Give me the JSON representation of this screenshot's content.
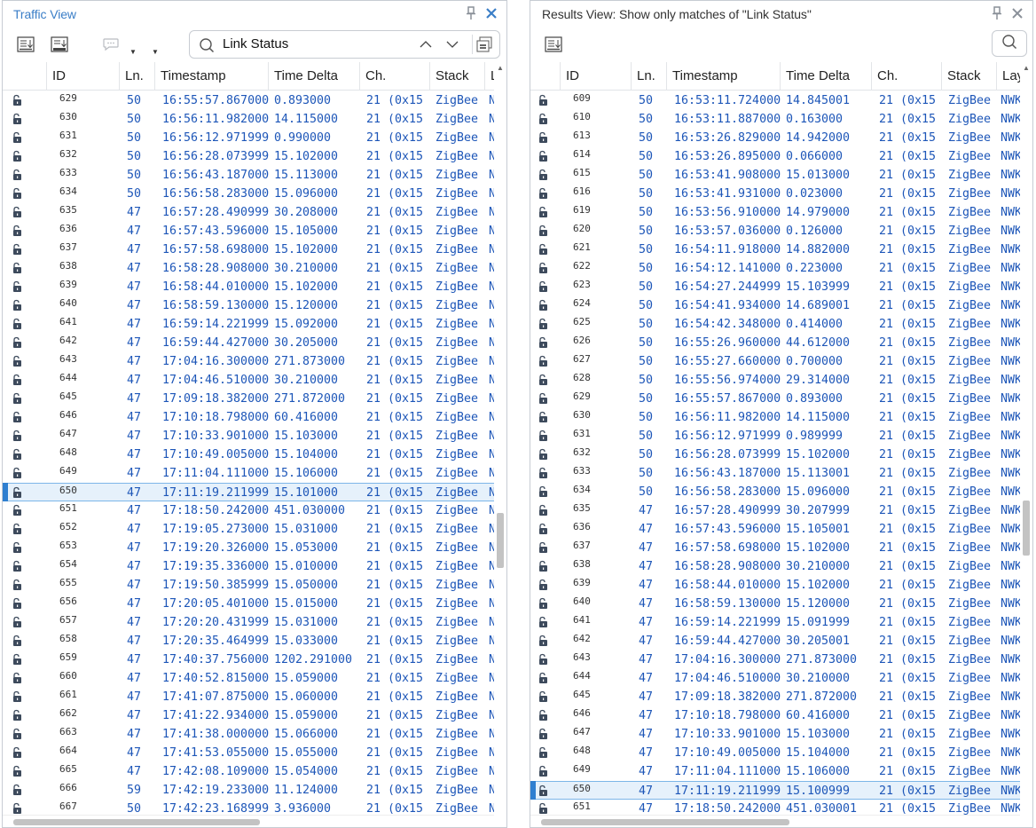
{
  "left": {
    "title": "Traffic View",
    "search_value": "Link Status",
    "columns": [
      "ID",
      "Ln.",
      "Timestamp",
      "Time Delta",
      "Ch.",
      "Stack",
      "L"
    ],
    "selected_id": "650",
    "rows": [
      [
        "629",
        "50",
        "16:55:57.867000",
        "0.893000",
        "21 (0x15",
        "ZigBee",
        "N"
      ],
      [
        "630",
        "50",
        "16:56:11.982000",
        "14.115000",
        "21 (0x15",
        "ZigBee",
        "N"
      ],
      [
        "631",
        "50",
        "16:56:12.971999",
        "0.990000",
        "21 (0x15",
        "ZigBee",
        "N"
      ],
      [
        "632",
        "50",
        "16:56:28.073999",
        "15.102000",
        "21 (0x15",
        "ZigBee",
        "N"
      ],
      [
        "633",
        "50",
        "16:56:43.187000",
        "15.113000",
        "21 (0x15",
        "ZigBee",
        "N"
      ],
      [
        "634",
        "50",
        "16:56:58.283000",
        "15.096000",
        "21 (0x15",
        "ZigBee",
        "N"
      ],
      [
        "635",
        "47",
        "16:57:28.490999",
        "30.208000",
        "21 (0x15",
        "ZigBee",
        "N"
      ],
      [
        "636",
        "47",
        "16:57:43.596000",
        "15.105000",
        "21 (0x15",
        "ZigBee",
        "N"
      ],
      [
        "637",
        "47",
        "16:57:58.698000",
        "15.102000",
        "21 (0x15",
        "ZigBee",
        "N"
      ],
      [
        "638",
        "47",
        "16:58:28.908000",
        "30.210000",
        "21 (0x15",
        "ZigBee",
        "N"
      ],
      [
        "639",
        "47",
        "16:58:44.010000",
        "15.102000",
        "21 (0x15",
        "ZigBee",
        "N"
      ],
      [
        "640",
        "47",
        "16:58:59.130000",
        "15.120000",
        "21 (0x15",
        "ZigBee",
        "N"
      ],
      [
        "641",
        "47",
        "16:59:14.221999",
        "15.092000",
        "21 (0x15",
        "ZigBee",
        "N"
      ],
      [
        "642",
        "47",
        "16:59:44.427000",
        "30.205000",
        "21 (0x15",
        "ZigBee",
        "N"
      ],
      [
        "643",
        "47",
        "17:04:16.300000",
        "271.873000",
        "21 (0x15",
        "ZigBee",
        "N"
      ],
      [
        "644",
        "47",
        "17:04:46.510000",
        "30.210000",
        "21 (0x15",
        "ZigBee",
        "N"
      ],
      [
        "645",
        "47",
        "17:09:18.382000",
        "271.872000",
        "21 (0x15",
        "ZigBee",
        "N"
      ],
      [
        "646",
        "47",
        "17:10:18.798000",
        "60.416000",
        "21 (0x15",
        "ZigBee",
        "N"
      ],
      [
        "647",
        "47",
        "17:10:33.901000",
        "15.103000",
        "21 (0x15",
        "ZigBee",
        "N"
      ],
      [
        "648",
        "47",
        "17:10:49.005000",
        "15.104000",
        "21 (0x15",
        "ZigBee",
        "N"
      ],
      [
        "649",
        "47",
        "17:11:04.111000",
        "15.106000",
        "21 (0x15",
        "ZigBee",
        "N"
      ],
      [
        "650",
        "47",
        "17:11:19.211999",
        "15.101000",
        "21 (0x15",
        "ZigBee",
        "N"
      ],
      [
        "651",
        "47",
        "17:18:50.242000",
        "451.030000",
        "21 (0x15",
        "ZigBee",
        "N"
      ],
      [
        "652",
        "47",
        "17:19:05.273000",
        "15.031000",
        "21 (0x15",
        "ZigBee",
        "N"
      ],
      [
        "653",
        "47",
        "17:19:20.326000",
        "15.053000",
        "21 (0x15",
        "ZigBee",
        "N"
      ],
      [
        "654",
        "47",
        "17:19:35.336000",
        "15.010000",
        "21 (0x15",
        "ZigBee",
        "N"
      ],
      [
        "655",
        "47",
        "17:19:50.385999",
        "15.050000",
        "21 (0x15",
        "ZigBee",
        "N"
      ],
      [
        "656",
        "47",
        "17:20:05.401000",
        "15.015000",
        "21 (0x15",
        "ZigBee",
        "N"
      ],
      [
        "657",
        "47",
        "17:20:20.431999",
        "15.031000",
        "21 (0x15",
        "ZigBee",
        "N"
      ],
      [
        "658",
        "47",
        "17:20:35.464999",
        "15.033000",
        "21 (0x15",
        "ZigBee",
        "N"
      ],
      [
        "659",
        "47",
        "17:40:37.756000",
        "1202.291000",
        "21 (0x15",
        "ZigBee",
        "N"
      ],
      [
        "660",
        "47",
        "17:40:52.815000",
        "15.059000",
        "21 (0x15",
        "ZigBee",
        "N"
      ],
      [
        "661",
        "47",
        "17:41:07.875000",
        "15.060000",
        "21 (0x15",
        "ZigBee",
        "N"
      ],
      [
        "662",
        "47",
        "17:41:22.934000",
        "15.059000",
        "21 (0x15",
        "ZigBee",
        "N"
      ],
      [
        "663",
        "47",
        "17:41:38.000000",
        "15.066000",
        "21 (0x15",
        "ZigBee",
        "N"
      ],
      [
        "664",
        "47",
        "17:41:53.055000",
        "15.055000",
        "21 (0x15",
        "ZigBee",
        "N"
      ],
      [
        "665",
        "47",
        "17:42:08.109000",
        "15.054000",
        "21 (0x15",
        "ZigBee",
        "N"
      ],
      [
        "666",
        "59",
        "17:42:19.233000",
        "11.124000",
        "21 (0x15",
        "ZigBee",
        "N"
      ],
      [
        "667",
        "50",
        "17:42:23.168999",
        "3.936000",
        "21 (0x15",
        "ZigBee",
        "N"
      ]
    ]
  },
  "right": {
    "title": "Results View: Show only matches of \"Link Status\"",
    "columns": [
      "ID",
      "Ln.",
      "Timestamp",
      "Time Delta",
      "Ch.",
      "Stack",
      "Lay"
    ],
    "selected_id": "650",
    "rows": [
      [
        "609",
        "50",
        "16:53:11.724000",
        "14.845001",
        "21 (0x15",
        "ZigBee",
        "NWK"
      ],
      [
        "610",
        "50",
        "16:53:11.887000",
        "0.163000",
        "21 (0x15",
        "ZigBee",
        "NWK"
      ],
      [
        "613",
        "50",
        "16:53:26.829000",
        "14.942000",
        "21 (0x15",
        "ZigBee",
        "NWK"
      ],
      [
        "614",
        "50",
        "16:53:26.895000",
        "0.066000",
        "21 (0x15",
        "ZigBee",
        "NWK"
      ],
      [
        "615",
        "50",
        "16:53:41.908000",
        "15.013000",
        "21 (0x15",
        "ZigBee",
        "NWK"
      ],
      [
        "616",
        "50",
        "16:53:41.931000",
        "0.023000",
        "21 (0x15",
        "ZigBee",
        "NWK"
      ],
      [
        "619",
        "50",
        "16:53:56.910000",
        "14.979000",
        "21 (0x15",
        "ZigBee",
        "NWK"
      ],
      [
        "620",
        "50",
        "16:53:57.036000",
        "0.126000",
        "21 (0x15",
        "ZigBee",
        "NWK"
      ],
      [
        "621",
        "50",
        "16:54:11.918000",
        "14.882000",
        "21 (0x15",
        "ZigBee",
        "NWK"
      ],
      [
        "622",
        "50",
        "16:54:12.141000",
        "0.223000",
        "21 (0x15",
        "ZigBee",
        "NWK"
      ],
      [
        "623",
        "50",
        "16:54:27.244999",
        "15.103999",
        "21 (0x15",
        "ZigBee",
        "NWK"
      ],
      [
        "624",
        "50",
        "16:54:41.934000",
        "14.689001",
        "21 (0x15",
        "ZigBee",
        "NWK"
      ],
      [
        "625",
        "50",
        "16:54:42.348000",
        "0.414000",
        "21 (0x15",
        "ZigBee",
        "NWK"
      ],
      [
        "626",
        "50",
        "16:55:26.960000",
        "44.612000",
        "21 (0x15",
        "ZigBee",
        "NWK"
      ],
      [
        "627",
        "50",
        "16:55:27.660000",
        "0.700000",
        "21 (0x15",
        "ZigBee",
        "NWK"
      ],
      [
        "628",
        "50",
        "16:55:56.974000",
        "29.314000",
        "21 (0x15",
        "ZigBee",
        "NWK"
      ],
      [
        "629",
        "50",
        "16:55:57.867000",
        "0.893000",
        "21 (0x15",
        "ZigBee",
        "NWK"
      ],
      [
        "630",
        "50",
        "16:56:11.982000",
        "14.115000",
        "21 (0x15",
        "ZigBee",
        "NWK"
      ],
      [
        "631",
        "50",
        "16:56:12.971999",
        "0.989999",
        "21 (0x15",
        "ZigBee",
        "NWK"
      ],
      [
        "632",
        "50",
        "16:56:28.073999",
        "15.102000",
        "21 (0x15",
        "ZigBee",
        "NWK"
      ],
      [
        "633",
        "50",
        "16:56:43.187000",
        "15.113001",
        "21 (0x15",
        "ZigBee",
        "NWK"
      ],
      [
        "634",
        "50",
        "16:56:58.283000",
        "15.096000",
        "21 (0x15",
        "ZigBee",
        "NWK"
      ],
      [
        "635",
        "47",
        "16:57:28.490999",
        "30.207999",
        "21 (0x15",
        "ZigBee",
        "NWK"
      ],
      [
        "636",
        "47",
        "16:57:43.596000",
        "15.105001",
        "21 (0x15",
        "ZigBee",
        "NWK"
      ],
      [
        "637",
        "47",
        "16:57:58.698000",
        "15.102000",
        "21 (0x15",
        "ZigBee",
        "NWK"
      ],
      [
        "638",
        "47",
        "16:58:28.908000",
        "30.210000",
        "21 (0x15",
        "ZigBee",
        "NWK"
      ],
      [
        "639",
        "47",
        "16:58:44.010000",
        "15.102000",
        "21 (0x15",
        "ZigBee",
        "NWK"
      ],
      [
        "640",
        "47",
        "16:58:59.130000",
        "15.120000",
        "21 (0x15",
        "ZigBee",
        "NWK"
      ],
      [
        "641",
        "47",
        "16:59:14.221999",
        "15.091999",
        "21 (0x15",
        "ZigBee",
        "NWK"
      ],
      [
        "642",
        "47",
        "16:59:44.427000",
        "30.205001",
        "21 (0x15",
        "ZigBee",
        "NWK"
      ],
      [
        "643",
        "47",
        "17:04:16.300000",
        "271.873000",
        "21 (0x15",
        "ZigBee",
        "NWK"
      ],
      [
        "644",
        "47",
        "17:04:46.510000",
        "30.210000",
        "21 (0x15",
        "ZigBee",
        "NWK"
      ],
      [
        "645",
        "47",
        "17:09:18.382000",
        "271.872000",
        "21 (0x15",
        "ZigBee",
        "NWK"
      ],
      [
        "646",
        "47",
        "17:10:18.798000",
        "60.416000",
        "21 (0x15",
        "ZigBee",
        "NWK"
      ],
      [
        "647",
        "47",
        "17:10:33.901000",
        "15.103000",
        "21 (0x15",
        "ZigBee",
        "NWK"
      ],
      [
        "648",
        "47",
        "17:10:49.005000",
        "15.104000",
        "21 (0x15",
        "ZigBee",
        "NWK"
      ],
      [
        "649",
        "47",
        "17:11:04.111000",
        "15.106000",
        "21 (0x15",
        "ZigBee",
        "NWK"
      ],
      [
        "650",
        "47",
        "17:11:19.211999",
        "15.100999",
        "21 (0x15",
        "ZigBee",
        "NWK"
      ],
      [
        "651",
        "47",
        "17:18:50.242000",
        "451.030001",
        "21 (0x15",
        "ZigBee",
        "NWK"
      ]
    ]
  },
  "icons": {
    "row": "unlock-icon",
    "pin": "pin-icon",
    "close": "close-icon",
    "search": "search-icon"
  },
  "colors": {
    "data_text": "#1d56b8",
    "title_accent": "#3a7ec7",
    "selection": "#e6f1fb",
    "selection_bar": "#2f7fd0"
  }
}
